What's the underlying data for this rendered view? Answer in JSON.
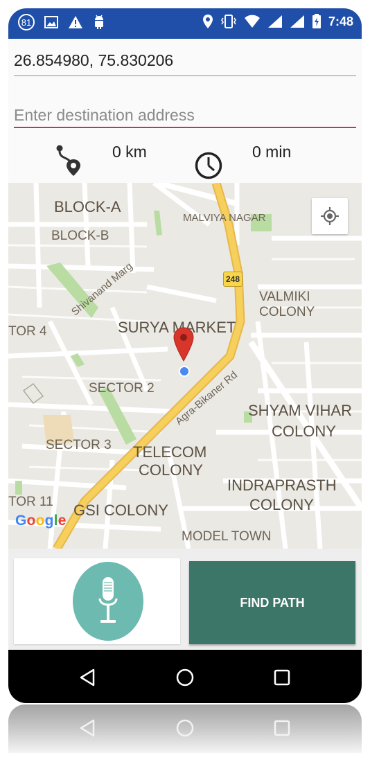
{
  "status_bar": {
    "notification_count": "81",
    "time": "7:48",
    "background_color": "#1f4fa8",
    "left_icons": [
      "notification-count-badge",
      "image-icon",
      "warning-icon",
      "android-icon"
    ],
    "right_icons": [
      "location-icon",
      "vibrate-icon",
      "wifi-icon",
      "signal-icon",
      "signal-icon",
      "battery-charging-icon"
    ]
  },
  "origin": {
    "value": "26.854980, 75.830206"
  },
  "destination": {
    "placeholder": "Enter destination address",
    "value": "",
    "underline_color": "#e91e63"
  },
  "stats": {
    "distance": "0 km",
    "duration": "0 min",
    "icons": [
      "route-icon",
      "clock-icon"
    ]
  },
  "map": {
    "labels": {
      "block_a": "BLOCK-A",
      "block_b": "BLOCK-B",
      "malviya_nagar": "MALVIYA NAGAR",
      "shivanand_marg": "Shivanand Marg",
      "route_248": "248",
      "valmiki_colony_1": "VALMIKI",
      "valmiki_colony_2": "COLONY",
      "tor_4": "TOR 4",
      "surya_market": "SURYA MARKET",
      "agra_bikaner_rd": "Agra-Bikaner Rd",
      "sector_2": "SECTOR 2",
      "shyam_vihar_1": "SHYAM VIHAR",
      "shyam_vihar_2": "COLONY",
      "sector_3": "SECTOR 3",
      "telecom_colony_1": "TELECOM",
      "telecom_colony_2": "COLONY",
      "indraprasth_1": "INDRAPRASTH",
      "indraprasth_2": "COLONY",
      "tor_11": "TOR 11",
      "gsi_colony": "GSI COLONY",
      "model_town": "MODEL TOWN"
    },
    "google_logo": [
      "G",
      "o",
      "o",
      "g",
      "l",
      "e"
    ],
    "google_colors": [
      "#4285f4",
      "#ea4335",
      "#fbbc05",
      "#4285f4",
      "#34a853",
      "#ea4335"
    ],
    "marker_color": "#d9362b",
    "current_location_color": "#4a89f3",
    "road_color": "#f6cf5c"
  },
  "actions": {
    "mic_icon": "microphone-icon",
    "mic_color": "#6cbab0",
    "find_path_label": "FIND PATH",
    "find_path_color": "#3b7668"
  },
  "nav_bar": {
    "icons": [
      "back-icon",
      "home-icon",
      "recents-icon"
    ]
  }
}
